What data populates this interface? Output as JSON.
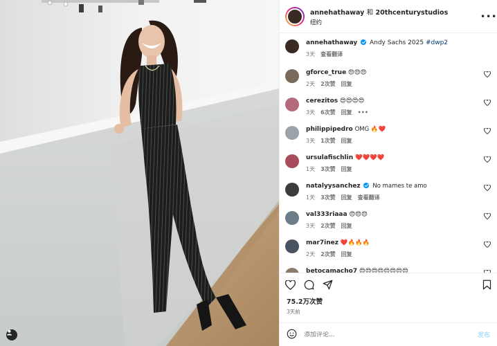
{
  "header": {
    "username": "annehathaway",
    "collab_sep": "和",
    "collaborator": "20thcenturystudios",
    "location": "纽约"
  },
  "caption": {
    "username": "annehathaway",
    "text": "Andy Sachs 2025",
    "hashtag": "#dwp2",
    "time": "3天",
    "translate": "查看翻译"
  },
  "comments": [
    {
      "username": "gforce_true",
      "text": "😍😍😍",
      "time": "2天",
      "likes": "2次赞",
      "reply": "回复",
      "avatar_color": "#7a6a5c"
    },
    {
      "username": "cerezitos",
      "text": "😍😍😍😍",
      "time": "3天",
      "likes": "6次赞",
      "reply": "回复",
      "extra": "•••",
      "avatar_color": "#b36a7a"
    },
    {
      "username": "philippipedro",
      "text": "OMG 🔥❤️",
      "time": "3天",
      "likes": "1次赞",
      "reply": "回复",
      "avatar_color": "#9aa3a8"
    },
    {
      "username": "ursulafischlin",
      "text": "❤️❤️❤️❤️",
      "time": "1天",
      "likes": "3次赞",
      "reply": "回复",
      "avatar_color": "#a64c5a"
    },
    {
      "username": "natalyysanchez",
      "verified": true,
      "text": "No mames te amo",
      "time": "1天",
      "likes": "3次赞",
      "reply": "回复",
      "translate": "查看翻译",
      "avatar_color": "#3b3b3b"
    },
    {
      "username": "val333riaaa",
      "text": "😍😍😍",
      "time": "3天",
      "likes": "2次赞",
      "reply": "回复",
      "avatar_color": "#6d7d88"
    },
    {
      "username": "mar7inez",
      "text": "❤️🔥🔥🔥",
      "time": "2天",
      "likes": "2次赞",
      "reply": "回复",
      "avatar_color": "#4a5460"
    },
    {
      "username": "betocamacho7",
      "text": "😍😍😍😍😍😍😍😍",
      "time": "",
      "likes": "",
      "reply": "",
      "avatar_color": "#8b7b6c"
    }
  ],
  "stats": {
    "likes": "75.2万次赞",
    "date": "3天前"
  },
  "composer": {
    "placeholder": "添加评论...",
    "publish": "发布"
  },
  "icons": {
    "heart": "heart-icon",
    "comment": "comment-icon",
    "share": "share-icon",
    "save": "bookmark-icon",
    "emoji": "emoji-icon",
    "more": "more-icon",
    "user_tag": "person-icon"
  }
}
